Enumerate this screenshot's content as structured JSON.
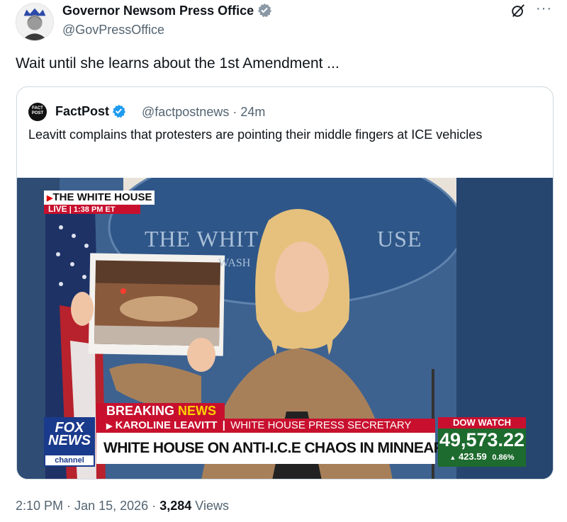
{
  "tweet": {
    "author_name": "Governor Newsom Press Office",
    "author_handle": "@GovPressOffice",
    "text": "Wait until she learns about the 1st Amendment ...",
    "time": "2:10 PM",
    "date": "Jan 15, 2026",
    "views_count": "3,284",
    "views_label": "Views",
    "more_label": "···",
    "grok_icon": "slashed-circle-icon"
  },
  "quote": {
    "logo_text": "FACT POST",
    "author_name": "FactPost",
    "author_handle": "@factpostnews",
    "age": "24m",
    "text": "Leavitt complains that protesters are pointing their middle fingers at ICE vehicles"
  },
  "video": {
    "bug_title": "THE WHITE HOUSE",
    "bug_live": "LIVE",
    "bug_time": "1:38 PM ET",
    "seal_line1": "THE WHIT",
    "seal_line2": "USE",
    "seal_line3": "WASH",
    "breaking_1": "BREAKING ",
    "breaking_2": "NEWS",
    "speaker_name": "KAROLINE LEAVITT",
    "speaker_role": "WHITE HOUSE PRESS SECRETARY",
    "headline": "WHITE HOUSE ON ANTI-I.C.E CHAOS IN MINNEAPOLIS",
    "fox_line1": "FOX",
    "fox_line2": "NEWS",
    "fox_channel": "channel",
    "dow_label": "DOW WATCH",
    "dow_value": "49,573.22",
    "dow_change": "423.59",
    "dow_pct": "0.86%"
  },
  "colors": {
    "verified": "#1d9bf0",
    "fox_red": "#c8102e",
    "fox_blue": "#1a3a8c",
    "dow_green": "#1d6b2e"
  }
}
